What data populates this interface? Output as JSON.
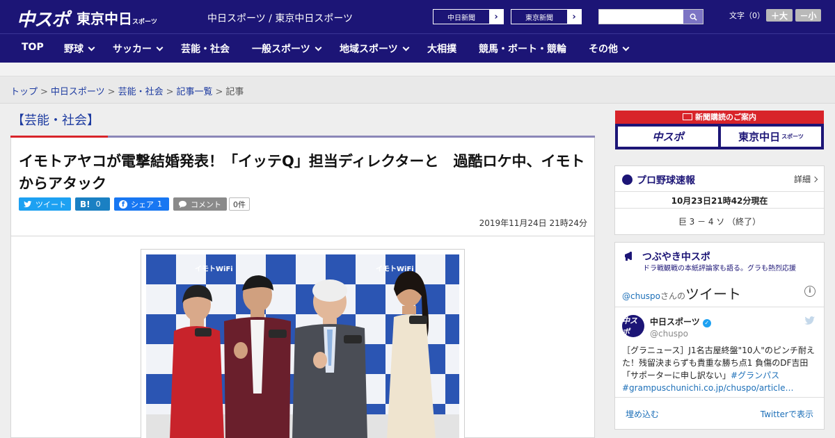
{
  "header": {
    "logo_chuspo": "中スポ",
    "logo_tokyo": "東京中日",
    "logo_tokyo_sub": "スポーツ",
    "site_title": "中日スポーツ / 東京中日スポーツ",
    "links": [
      {
        "label": "中日新聞"
      },
      {
        "label": "東京新聞"
      }
    ],
    "search": {
      "placeholder": "",
      "icon": "search-icon"
    },
    "font_size_label": "文字（0）",
    "font_up": "＋大",
    "font_down": "－小"
  },
  "nav": {
    "items": [
      {
        "label": "TOP"
      },
      {
        "label": "野球"
      },
      {
        "label": "サッカー"
      },
      {
        "label": "芸能・社会"
      },
      {
        "label": "一般スポーツ"
      },
      {
        "label": "地域スポーツ"
      },
      {
        "label": "大相撲"
      },
      {
        "label": "競馬・ボート・競輪"
      },
      {
        "label": "その他"
      }
    ]
  },
  "breadcrumb": {
    "items": [
      "トップ",
      "中日スポーツ",
      "芸能・社会",
      "記事一覧"
    ],
    "current": "記事",
    "separator": ">"
  },
  "article": {
    "category": "【芸能・社会】",
    "headline": "イモトアヤコが電撃結婚発表！「イッテQ」担当ディレクターと　過酷ロケ中、イモトからアタック",
    "share": {
      "tweet": "ツイート",
      "hatena": "B!",
      "hatena_count": "0",
      "facebook": "シェア",
      "facebook_count": "1",
      "comment": "コメント",
      "comment_count": "0件"
    },
    "date": "2019年11月24日 21時24分",
    "photo_backdrop_text": "イモトWiFi"
  },
  "sidebar": {
    "subscribe": {
      "title": "新聞購読のご案内",
      "logo_left": "中スポ",
      "logo_right": "東京中日",
      "logo_right_sub": "スポーツ"
    },
    "baseball": {
      "title": "プロ野球速報",
      "more": "詳細",
      "time": "10月23日21時42分現在",
      "score": "巨 3 － 4 ソ （終了）"
    },
    "tweets": {
      "title": "つぶやき中スポ",
      "subtitle": "ドラ戦観戦の本紙評論家も語る。グラも熱烈応援",
      "account": "@chuspo",
      "account_suffix": "さんの",
      "tweets_label": "ツイート",
      "user_name": "中日スポーツ",
      "user_handle": "@chuspo",
      "avatar_text": "中スポ",
      "tweet_text": "［グラニュース］J1名古屋終盤\"10人\"のピンチ耐えた！残留決まらずも貴重な勝ち点1 負傷のDF吉田「サポーターに申し訳ない」",
      "tweet_tag": "#グランパス",
      "tweet_link": "#grampuschunichi.co.jp/chuspo/article…",
      "embed": "埋め込む",
      "view_on_twitter": "Twitterで表示"
    }
  },
  "colors": {
    "brand_navy": "#1c1576",
    "accent_red": "#d8242a",
    "link_blue": "#1c3aa0",
    "twitter_blue": "#1da1f2"
  }
}
